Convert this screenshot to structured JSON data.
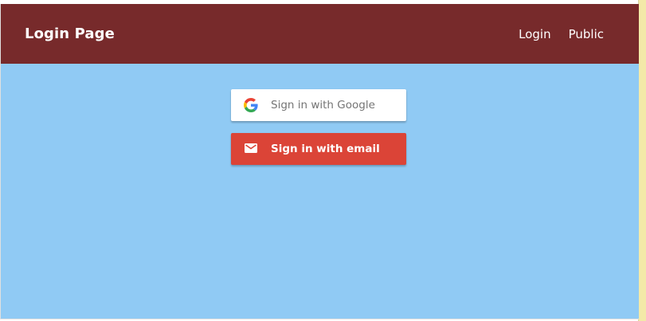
{
  "header": {
    "title": "Login Page",
    "nav": [
      {
        "label": "Login"
      },
      {
        "label": "Public"
      }
    ]
  },
  "auth": {
    "google": {
      "label": "Sign in with Google",
      "icon": "google-icon"
    },
    "email": {
      "label": "Sign in with email",
      "icon": "mail-icon"
    }
  },
  "colors": {
    "navbar": "#772a2b",
    "background": "#90caf4",
    "email_button": "#db4437",
    "google_button": "#ffffff"
  }
}
